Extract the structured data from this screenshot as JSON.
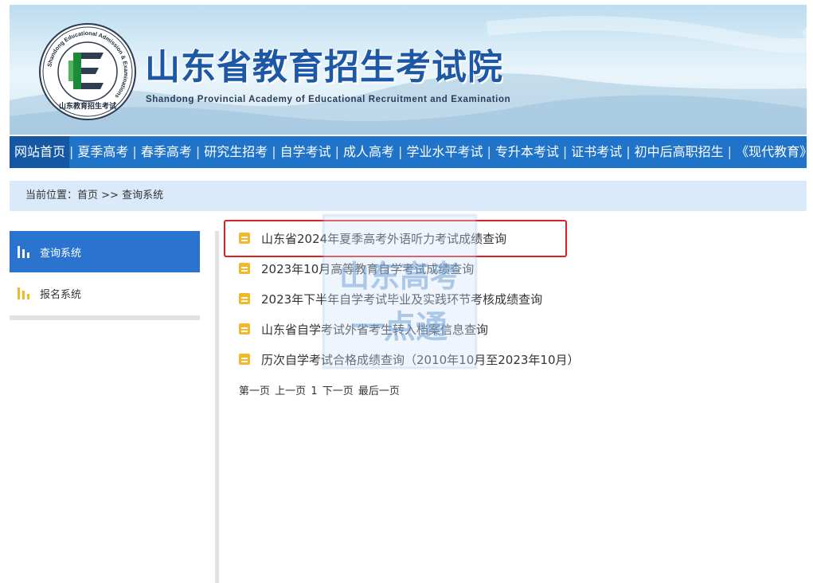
{
  "header": {
    "title": "山东省教育招生考试院",
    "subtitle": "Shandong Provincial Academy of Educational Recruitment and Examination",
    "logo": {
      "ring_text": "Shandong Educational Admission & Examinations",
      "bottom_text": "山东教育招生考试",
      "letter": "E",
      "icon": "academy-logo"
    }
  },
  "nav": {
    "items": [
      {
        "label": "网站首页",
        "active": true
      },
      {
        "label": "夏季高考"
      },
      {
        "label": "春季高考"
      },
      {
        "label": "研究生招考"
      },
      {
        "label": "自学考试"
      },
      {
        "label": "成人高考"
      },
      {
        "label": "学业水平考试"
      },
      {
        "label": "专升本考试"
      },
      {
        "label": "证书考试"
      },
      {
        "label": "初中后高职招生"
      },
      {
        "label": "《现代教育》"
      }
    ],
    "separator": "|"
  },
  "breadcrumb": {
    "prefix": "当前位置：",
    "home": "首页",
    "sep": " >> ",
    "current": "查询系统"
  },
  "sidebar": {
    "items": [
      {
        "label": "查询系统",
        "active": true,
        "icon": "bar-chart-icon"
      },
      {
        "label": "报名系统",
        "active": false,
        "icon": "bar-chart-icon"
      }
    ]
  },
  "list": {
    "items": [
      {
        "text": "山东省2024年夏季高考外语听力考试成绩查询",
        "highlighted": true
      },
      {
        "text": "2023年10月高等教育自学考试成绩查询"
      },
      {
        "text": "2023年下半年自学考试毕业及实践环节考核成绩查询"
      },
      {
        "text": "山东省自学考试外省考生转入档案信息查询"
      },
      {
        "text": "历次自学考试合格成绩查询（2010年10月至2023年10月）"
      }
    ],
    "icon": "document-icon"
  },
  "pager": {
    "first": "第一页",
    "prev": "上一页",
    "current": "1",
    "next": "下一页",
    "last": "最后一页"
  },
  "watermark": {
    "line1": "山东高考",
    "line2": "一点通"
  },
  "colors": {
    "nav_bg": "#1f74c9",
    "nav_active": "#1458a3",
    "sidebar_active": "#2a74cf",
    "breadcrumb_bg": "#dbeafa",
    "icon_yellow": "#f3b72a",
    "highlight_red": "#e02020",
    "title_blue": "#1c58a6"
  }
}
